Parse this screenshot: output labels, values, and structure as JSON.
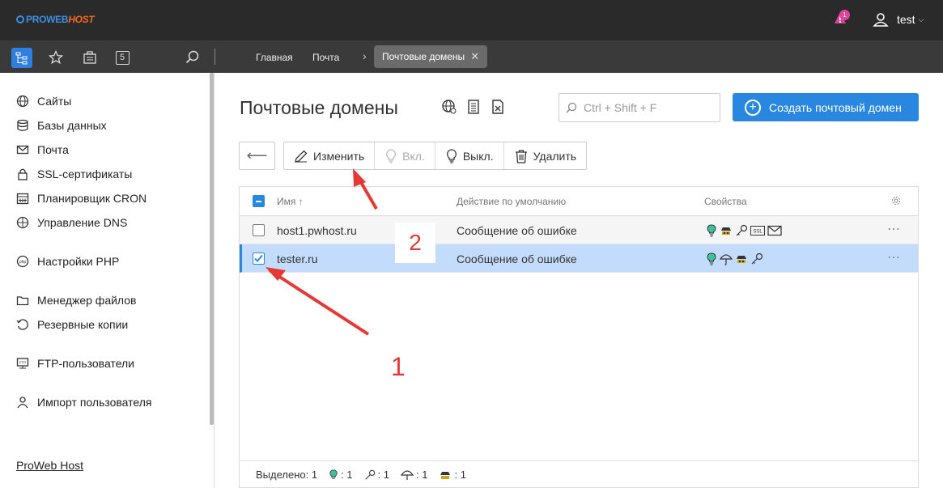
{
  "header": {
    "logo_main": "PROWEB",
    "logo_accent": "HOST",
    "notification_count": "1",
    "user_name": "test"
  },
  "toolbar": {
    "tab_number": "5"
  },
  "breadcrumbs": {
    "home": "Главная",
    "mail": "Почта",
    "active": "Почтовые домены"
  },
  "sidebar": {
    "items": [
      {
        "label": "Сайты",
        "icon": "globe-icon"
      },
      {
        "label": "Базы данных",
        "icon": "database-icon"
      },
      {
        "label": "Почта",
        "icon": "mail-icon"
      },
      {
        "label": "SSL-сертификаты",
        "icon": "lock-icon"
      },
      {
        "label": "Планировщик CRON",
        "icon": "calendar-icon"
      },
      {
        "label": "Управление DNS",
        "icon": "dns-icon"
      },
      {
        "label": "Настройки PHP",
        "icon": "php-icon"
      },
      {
        "label": "Менеджер файлов",
        "icon": "folder-icon"
      },
      {
        "label": "Резервные копии",
        "icon": "backup-icon"
      },
      {
        "label": "FTP-пользователи",
        "icon": "ftp-icon"
      },
      {
        "label": "Импорт пользователя",
        "icon": "user-import-icon"
      }
    ],
    "footer_link": "ProWeb Host"
  },
  "page": {
    "title": "Почтовые домены",
    "search_placeholder": "Ctrl + Shift + F",
    "create_button": "Создать почтовый домен"
  },
  "actions": {
    "edit": "Изменить",
    "enable": "Вкл.",
    "disable": "Выкл.",
    "delete": "Удалить"
  },
  "table": {
    "headers": {
      "name": "Имя ↑",
      "default_action": "Действие по умолчанию",
      "properties": "Свойства"
    },
    "rows": [
      {
        "name": "host1.pwhost.ru",
        "action": "Сообщение об ошибке",
        "selected": false
      },
      {
        "name": "tester.ru",
        "action": "Сообщение об ошибке",
        "selected": true
      }
    ]
  },
  "status_bar": {
    "selected_label": "Выделено: 1",
    "bulb_count": ": 1",
    "key_count": ": 1",
    "umbrella_count": ": 1",
    "spy_count": ": 1"
  },
  "annotations": {
    "label_1": "1",
    "label_2": "2"
  },
  "colors": {
    "accent": "#2a87e0",
    "topbar": "#2a2a2a",
    "selected_row": "#c3dcfb",
    "annotation": "#e53935"
  }
}
